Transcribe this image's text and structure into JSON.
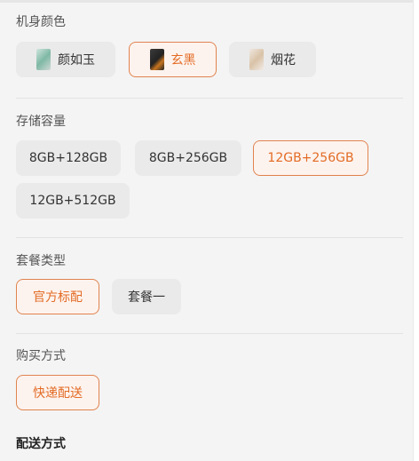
{
  "color": {
    "label": "机身颜色",
    "options": [
      {
        "name": "颜如玉",
        "selected": false
      },
      {
        "name": "玄黑",
        "selected": true
      },
      {
        "name": "烟花",
        "selected": false
      }
    ]
  },
  "storage": {
    "label": "存储容量",
    "options": [
      {
        "name": "8GB+128GB",
        "selected": false
      },
      {
        "name": "8GB+256GB",
        "selected": false
      },
      {
        "name": "12GB+256GB",
        "selected": true
      },
      {
        "name": "12GB+512GB",
        "selected": false
      }
    ]
  },
  "package": {
    "label": "套餐类型",
    "options": [
      {
        "name": "官方标配",
        "selected": true
      },
      {
        "name": "套餐一",
        "selected": false
      }
    ]
  },
  "purchase": {
    "label": "购买方式",
    "options": [
      {
        "name": "快递配送",
        "selected": true
      }
    ]
  },
  "delivery": {
    "label": "配送方式"
  },
  "colors": {
    "accent": "#e36b25",
    "accent_border": "#e0834f",
    "chip_bg": "#eaeaea",
    "page_bg": "#f4f4f4"
  }
}
